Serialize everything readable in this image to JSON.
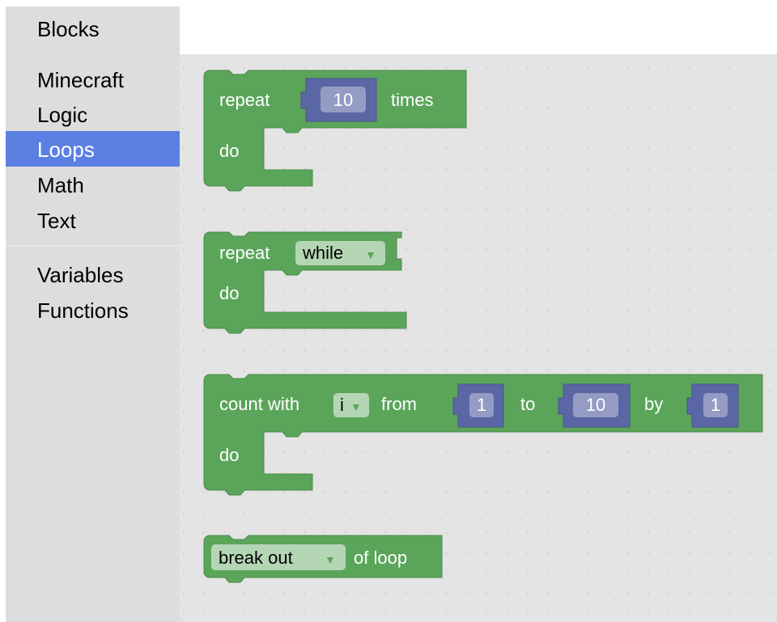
{
  "toolbox": {
    "header": "Blocks",
    "categories": [
      "Minecraft",
      "Logic",
      "Loops",
      "Math",
      "Text",
      "Variables",
      "Functions"
    ],
    "selected": "Loops"
  },
  "colors": {
    "loop_block": "#5ba55b",
    "number_block": "#5b67a5",
    "selected_category": "#5b80e4",
    "toolbox_bg": "#dddddd",
    "workspace_bg": "#e4e4e4"
  },
  "blocks": {
    "repeat_times": {
      "label": "repeat",
      "value": "10",
      "suffix": "times",
      "do": "do"
    },
    "repeat_while": {
      "label": "repeat",
      "mode": "while",
      "do": "do"
    },
    "count_with": {
      "label": "count with",
      "var": "i",
      "from_label": "from",
      "from": "1",
      "to_label": "to",
      "to": "10",
      "by_label": "by",
      "by": "1",
      "do": "do"
    },
    "break": {
      "mode": "break out",
      "suffix": "of loop"
    }
  }
}
